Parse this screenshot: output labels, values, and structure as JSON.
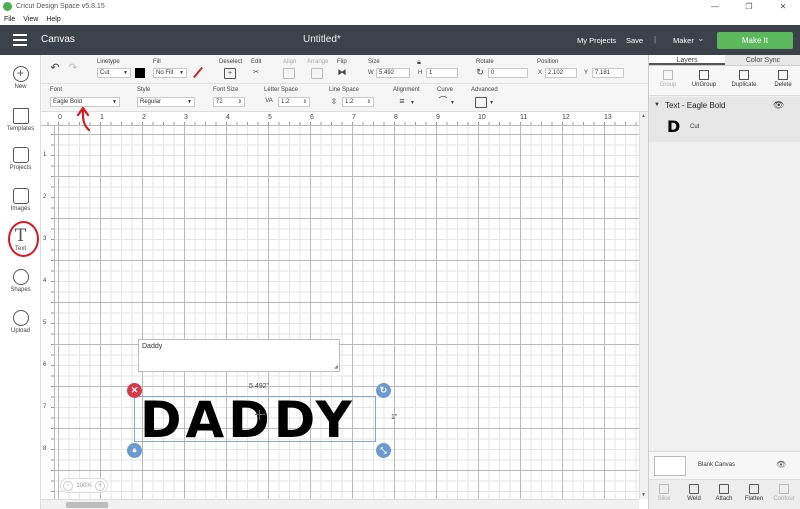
{
  "window": {
    "title": "Cricut Design Space  v5.8.15",
    "min": "—",
    "max": "❐",
    "close": "✕"
  },
  "menu": {
    "file": "File",
    "view": "View",
    "help": "Help"
  },
  "header": {
    "canvas_label": "Canvas",
    "doc_title": "Untitled*",
    "my_projects": "My Projects",
    "save": "Save",
    "separator": "|",
    "maker": "Maker",
    "make_it": "Make It"
  },
  "sidebar": {
    "new": "New",
    "templates": "Templates",
    "projects": "Projects",
    "images": "Images",
    "text": "Text",
    "shapes": "Shapes",
    "upload": "Upload"
  },
  "toolbar1": {
    "linetype_label": "Linetype",
    "linetype_value": "Cut",
    "fill_label": "Fill",
    "fill_value": "No Fill",
    "deselect": "Deselect",
    "edit": "Edit",
    "align": "Align",
    "arrange": "Arrange",
    "flip": "Flip",
    "size": "Size",
    "w_label": "W",
    "w_value": "5.492",
    "h_label": "H",
    "h_value": "1",
    "rotate": "Rotate",
    "rotate_value": "0",
    "position": "Position",
    "x_label": "X",
    "x_value": "2.102",
    "y_label": "Y",
    "y_value": "7.181"
  },
  "toolbar2": {
    "font_label": "Font",
    "font_value": "Eagle Bold",
    "style_label": "Style",
    "style_value": "Regular",
    "font_size_label": "Font Size",
    "font_size_value": "72",
    "letter_space_label": "Letter Space",
    "letter_space_value": "1.2",
    "line_space_label": "Line Space",
    "line_space_value": "1.2",
    "alignment_label": "Alignment",
    "curve_label": "Curve",
    "advanced_label": "Advanced"
  },
  "ruler": {
    "h": [
      "0",
      "1",
      "2",
      "3",
      "4",
      "5",
      "6",
      "7",
      "8",
      "9",
      "10",
      "11",
      "12",
      "13"
    ],
    "v": [
      "1",
      "2",
      "3",
      "4",
      "5",
      "6",
      "7",
      "8"
    ]
  },
  "canvas": {
    "textbox_value": "Daddy",
    "display_text": "DADDY",
    "width_label": "5.492\"",
    "height_label": "1\"",
    "zoom": "100%"
  },
  "right_panel": {
    "tab_layers": "Layers",
    "tab_color_sync": "Color Sync",
    "group": "Group",
    "ungroup": "UnGroup",
    "duplicate": "Duplicate",
    "delete": "Delete",
    "layer_name": "Text - Eagle Bold",
    "layer_thumb": "D",
    "layer_op": "Cut",
    "blank_canvas": "Blank Canvas",
    "slice": "Slice",
    "weld": "Weld",
    "attach": "Attach",
    "flatten": "Flatten",
    "contour": "Contour"
  },
  "colors": {
    "header_bg": "#3b4249",
    "make_it": "#5cb85c",
    "annotation_red": "#d9181f",
    "delete_handle": "#d9394a",
    "handle_blue": "#6a9ad0"
  }
}
